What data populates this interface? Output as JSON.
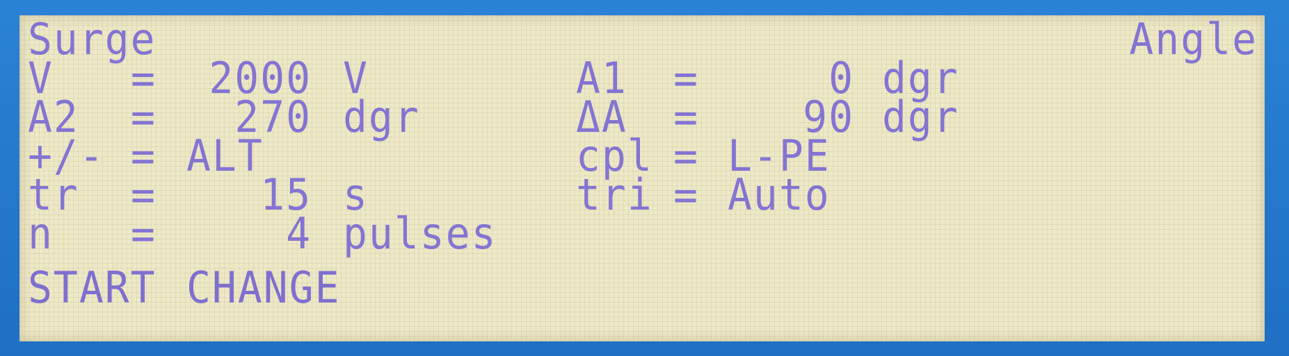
{
  "screen": {
    "title_left": "Surge",
    "title_right": "Angle"
  },
  "left_params": [
    {
      "name": "V",
      "eq": "=",
      "value": "2000",
      "unit": "V"
    },
    {
      "name": "A2",
      "eq": "=",
      "value": "270",
      "unit": "dgr"
    },
    {
      "name": "+/-",
      "eq": "=",
      "value": "ALT",
      "unit": ""
    },
    {
      "name": "tr",
      "eq": "=",
      "value": "15",
      "unit": "s"
    },
    {
      "name": "n",
      "eq": "=",
      "value": "4",
      "unit": "pulses"
    }
  ],
  "right_params": [
    {
      "name": "A1",
      "eq": "=",
      "value": "0",
      "unit": "dgr"
    },
    {
      "name": "ΔA",
      "eq": "=",
      "value": "90",
      "unit": "dgr"
    },
    {
      "name": "cpl",
      "eq": "=",
      "value": "L-PE",
      "unit": ""
    },
    {
      "name": "tri",
      "eq": "=",
      "value": "Auto",
      "unit": ""
    }
  ],
  "softkeys": {
    "start": "START",
    "change": "CHANGE"
  }
}
